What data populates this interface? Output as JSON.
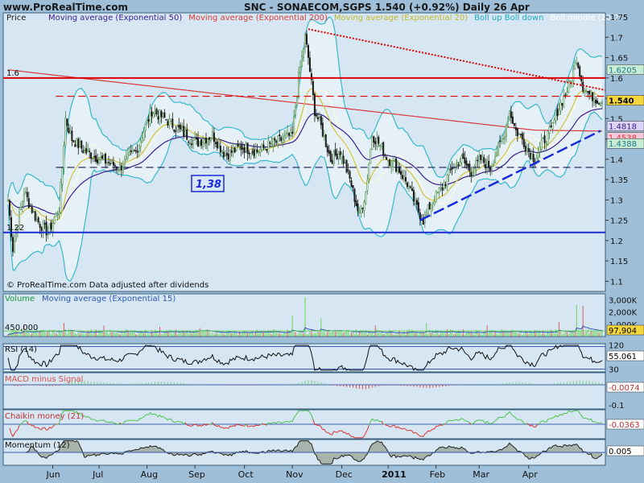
{
  "site": "www.ProRealTime.com",
  "header": {
    "ticker": "SNC - SONAECOM,SGPS",
    "quote": "1.540 (+0.92%)",
    "period": "Daily",
    "date": "26 Apr"
  },
  "footer_note": "© ProRealTime.com Data adjusted after dividends",
  "colors": {
    "background": "#9fbfd9",
    "panel": "#d6e6f2",
    "border": "#3a5f7f",
    "ema50": "#3c1e8c",
    "ema200": "#d83a3a",
    "ema20": "#d2c43c",
    "boll": "#38b8cc",
    "boll_mid": "#fffbe0",
    "candle_up": "#4a8a4a",
    "candle_down": "#1a1a1a",
    "support": "#1a2ad8",
    "resistance": "#e00000",
    "trend_down": "#e00000",
    "trend_up": "#1a2ad8",
    "volume": "#6ad35a",
    "volume_ma": "#2d58b0",
    "rsi": "#111111",
    "macd": "#d85050",
    "chaikin_pos": "#4cc34c",
    "chaikin_neg": "#e03030",
    "momentum": "#222222",
    "label_yellow": "#f4d63c",
    "label_pink": "#f6c8dc",
    "label_purple": "#dcd4f6",
    "label_green": "#c8ecd4",
    "label_white": "#ffffff"
  },
  "price_panel": {
    "legend": [
      {
        "text": "Price",
        "color": "#1a1a1a"
      },
      {
        "text": "Moving average (Exponential 50)",
        "color": "#3c1e8c"
      },
      {
        "text": "Moving average (Exponential 200)",
        "color": "#d83a3a"
      },
      {
        "text": "Moving average (Exponential 20)",
        "color": "#c4b82c"
      },
      {
        "text": "Boll up Boll down",
        "color": "#1ea8c0"
      },
      {
        "text": "Boll middle (20,2)",
        "color": "#ffffff"
      }
    ],
    "ylim": [
      1.075,
      1.76
    ],
    "yticks": [
      "1.75",
      "1.7",
      "1.65",
      "1.6",
      "1.55",
      "1.5",
      "1.45",
      "1.4",
      "1.35",
      "1.3",
      "1.25",
      "1.2",
      "1.15",
      "1.1"
    ],
    "ytick_values": [
      1.75,
      1.7,
      1.65,
      1.6,
      1.55,
      1.5,
      1.45,
      1.4,
      1.35,
      1.3,
      1.25,
      1.2,
      1.15,
      1.1
    ],
    "right_labels": [
      {
        "text": "1.6205",
        "value": 1.6205,
        "bg": "#c8ecd4",
        "color": "#1e7a8c"
      },
      {
        "text": "1.540",
        "value": 1.545,
        "bg": "#f4d63c",
        "color": "#000000"
      },
      {
        "text": "1.4818",
        "value": 1.4818,
        "bg": "#dcd4f6",
        "color": "#3c1e8c"
      },
      {
        "text": "1.4538",
        "value": 1.4538,
        "bg": "#f6c8dc",
        "color": "#d83a3a"
      },
      {
        "text": "1.4388",
        "value": 1.4388,
        "bg": "#c8ecd4",
        "color": "#1e7a8c"
      }
    ],
    "level_labels": [
      {
        "text": "1.6",
        "value": 1.6
      },
      {
        "text": "1.22",
        "value": 1.22
      }
    ],
    "box_label": "1,38",
    "levels": {
      "resistance": 1.6,
      "dashed_red": 1.555,
      "dashed_blue": 1.38,
      "support": 1.22
    },
    "trend_down": {
      "from": [
        "Oct",
        1.72
      ],
      "to": [
        "Apr",
        1.57
      ]
    },
    "trend_up": {
      "from": [
        "Jan",
        1.25
      ],
      "to": [
        "Apr",
        1.47
      ]
    }
  },
  "x_axis": {
    "labels": [
      "Jun",
      "Jul",
      "Aug",
      "Sep",
      "Oct",
      "Nov",
      "Dec",
      "2011",
      "Feb",
      "Mar",
      "Apr"
    ],
    "bold_index": 7
  },
  "chart_data": [
    {
      "type": "candlestick",
      "title": "SNC - SONAECOM,SGPS",
      "ylim": [
        1.075,
        1.76
      ],
      "x_range": [
        "May 2010",
        "26 Apr 2011"
      ],
      "waypoints": [
        [
          0,
          1.3
        ],
        [
          3,
          1.18
        ],
        [
          10,
          1.32
        ],
        [
          18,
          1.25
        ],
        [
          25,
          1.22
        ],
        [
          32,
          1.28
        ],
        [
          34,
          1.38
        ],
        [
          36,
          1.5
        ],
        [
          40,
          1.45
        ],
        [
          48,
          1.42
        ],
        [
          58,
          1.4
        ],
        [
          70,
          1.38
        ],
        [
          80,
          1.42
        ],
        [
          90,
          1.52
        ],
        [
          98,
          1.5
        ],
        [
          108,
          1.47
        ],
        [
          118,
          1.44
        ],
        [
          128,
          1.46
        ],
        [
          136,
          1.41
        ],
        [
          146,
          1.43
        ],
        [
          156,
          1.42
        ],
        [
          166,
          1.44
        ],
        [
          178,
          1.46
        ],
        [
          182,
          1.6
        ],
        [
          186,
          1.7
        ],
        [
          188,
          1.65
        ],
        [
          192,
          1.52
        ],
        [
          196,
          1.48
        ],
        [
          202,
          1.4
        ],
        [
          208,
          1.42
        ],
        [
          214,
          1.35
        ],
        [
          220,
          1.26
        ],
        [
          224,
          1.32
        ],
        [
          228,
          1.46
        ],
        [
          232,
          1.44
        ],
        [
          238,
          1.4
        ],
        [
          244,
          1.38
        ],
        [
          250,
          1.34
        ],
        [
          256,
          1.28
        ],
        [
          260,
          1.25
        ],
        [
          266,
          1.3
        ],
        [
          272,
          1.33
        ],
        [
          278,
          1.38
        ],
        [
          284,
          1.4
        ],
        [
          290,
          1.37
        ],
        [
          296,
          1.4
        ],
        [
          302,
          1.38
        ],
        [
          306,
          1.42
        ],
        [
          310,
          1.45
        ],
        [
          314,
          1.52
        ],
        [
          318,
          1.47
        ],
        [
          322,
          1.45
        ],
        [
          326,
          1.42
        ],
        [
          330,
          1.4
        ],
        [
          336,
          1.45
        ],
        [
          340,
          1.47
        ],
        [
          344,
          1.52
        ],
        [
          350,
          1.57
        ],
        [
          353,
          1.6
        ],
        [
          356,
          1.65
        ],
        [
          360,
          1.58
        ],
        [
          364,
          1.56
        ],
        [
          368,
          1.55
        ],
        [
          372,
          1.54
        ]
      ],
      "last": 1.54,
      "indicators": [
        "Exponential 50",
        "Exponential 200",
        "Exponential 20",
        "Bollinger (20,2)"
      ],
      "levels": [
        1.6,
        1.555,
        1.38,
        1.22
      ]
    },
    {
      "type": "bar",
      "title": "Volume",
      "overlay": "Moving average (Exponential 15)",
      "ylim": [
        0,
        3500000
      ],
      "yticks": [
        "3,000K",
        "2,000K",
        "1,000K"
      ],
      "ytick_values": [
        3000000,
        2000000,
        1000000
      ],
      "level": {
        "text": "450,000",
        "value": 450000
      },
      "last_ma": "97,904",
      "spikes": [
        [
          10,
          1000000
        ],
        [
          35,
          1100000
        ],
        [
          60,
          900000
        ],
        [
          95,
          800000
        ],
        [
          120,
          700000
        ],
        [
          178,
          1700000
        ],
        [
          186,
          3200000
        ],
        [
          196,
          1500000
        ],
        [
          230,
          900000
        ],
        [
          262,
          1100000
        ],
        [
          300,
          900000
        ],
        [
          345,
          1200000
        ],
        [
          356,
          2600000
        ],
        [
          360,
          2500000
        ]
      ]
    },
    {
      "type": "line",
      "title": "RSI (14)",
      "ylim": [
        25,
        75
      ],
      "tick_labels": [
        {
          "text": "120",
          "value": 73
        },
        {
          "text": "30",
          "value": 30
        }
      ],
      "levels": [
        70,
        30
      ],
      "last": "55.061"
    },
    {
      "type": "bar",
      "title": "MACD minus Signal",
      "ylim": [
        -0.12,
        0.06
      ],
      "yticks": [
        "0",
        "-0.1"
      ],
      "ytick_values": [
        0,
        -0.1
      ],
      "last": "-0.0074"
    },
    {
      "type": "line",
      "title": "Chaikin money (21)",
      "ylim": [
        -0.3,
        0.3
      ],
      "last": "-0.0363"
    },
    {
      "type": "area",
      "title": "Momentum (12)",
      "ylim": [
        -0.2,
        0.2
      ],
      "last": "0.005"
    }
  ],
  "volume_panel": {
    "title": "Volume",
    "ma_title": "Moving average (Exponential 15)"
  },
  "rsi_panel": {
    "title": "RSI (14)"
  },
  "macd_panel": {
    "title": "MACD minus Signal"
  },
  "chaikin_panel": {
    "title": "Chaikin money (21)"
  },
  "momentum_panel": {
    "title": "Momentum (12)"
  }
}
